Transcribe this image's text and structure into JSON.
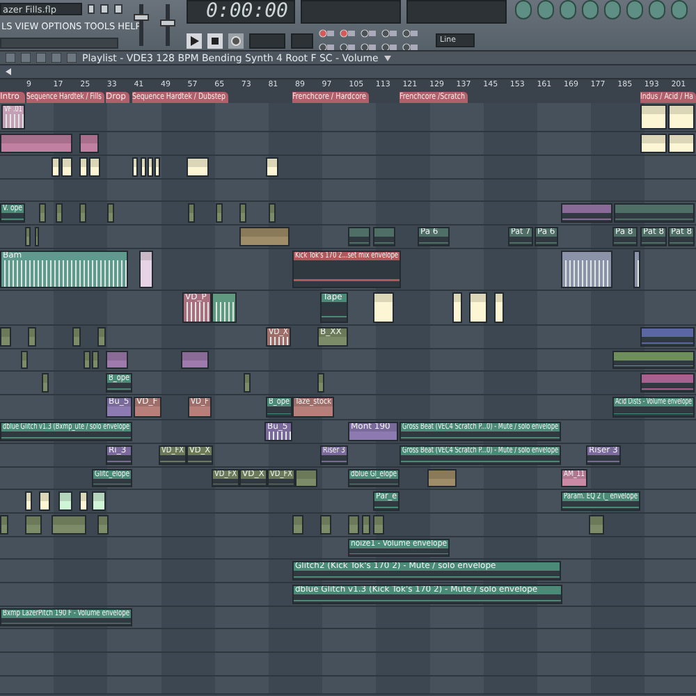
{
  "toolbar": {
    "file_name": "azer Fills.flp",
    "menu": [
      "LS",
      "VIEW",
      "OPTIONS",
      "TOOLS",
      "HELP"
    ],
    "sliders": [
      {
        "level": 0.72
      },
      {
        "level": 0.55
      }
    ],
    "time": "0:00:00",
    "snap": "Line"
  },
  "playlist": {
    "title": "Playlist - VDE3 128 BPM Bending Synth 4 Root F SC - Volume",
    "ruler": [
      "9",
      "17",
      "25",
      "33",
      "41",
      "49",
      "57",
      "65",
      "73",
      "81",
      "89",
      "97",
      "105",
      "113",
      "121",
      "129",
      "137",
      "145",
      "153",
      "161",
      "169",
      "177",
      "185",
      "193",
      "201"
    ],
    "markers": [
      {
        "label": "Intro"
      },
      {
        "label": "Sequence Hardtek / Fills"
      },
      {
        "label": "Drop"
      },
      {
        "label": "Sequence Hardtek / Dubstep"
      },
      {
        "label": "Frenchcore / Hardcore"
      },
      {
        "label": "Frenchcore /Scratch"
      },
      {
        "label": "Indus / Acid / Ha"
      }
    ],
    "tracks": [
      {
        "clips": [
          {
            "label": "VF .01",
            "color": "#c3a0b6",
            "kind": "audio"
          },
          {
            "color": "#dcd6b8",
            "kind": "pattern"
          },
          {
            "color": "#dcd6b8",
            "kind": "pattern"
          }
        ]
      },
      {
        "clips": [
          {
            "color": "#a86f8c",
            "kind": "pattern"
          },
          {
            "color": "#a86f8c",
            "kind": "pattern"
          },
          {
            "color": "#dcd6b8",
            "kind": "pattern"
          },
          {
            "color": "#dcd6b8",
            "kind": "pattern"
          }
        ]
      },
      {
        "clips": [
          {
            "color": "#dcd6b8",
            "kind": "pattern"
          },
          {
            "color": "#dcd6b8",
            "kind": "pattern"
          },
          {
            "color": "#dcd6b8",
            "kind": "pattern"
          },
          {
            "color": "#dcd6b8",
            "kind": "pattern"
          },
          {
            "color": "#dcd6b8",
            "kind": "pattern"
          },
          {
            "color": "#dcd6b8",
            "kind": "pattern"
          },
          {
            "color": "#dcd6b8",
            "kind": "pattern"
          },
          {
            "color": "#dcd6b8",
            "kind": "pattern"
          },
          {
            "color": "#dcd6b8",
            "kind": "pattern"
          },
          {
            "color": "#dcd6b8",
            "kind": "pattern"
          }
        ]
      },
      {
        "clips": [
          {
            "label": "V. ope",
            "color": "#4c8a78",
            "kind": "automation"
          },
          {
            "color": "#6d7a5a",
            "kind": "pattern"
          },
          {
            "color": "#6d7a5a",
            "kind": "pattern"
          },
          {
            "color": "#6d7a5a",
            "kind": "pattern"
          },
          {
            "color": "#6d7a5a",
            "kind": "pattern"
          },
          {
            "color": "#6d7a5a",
            "kind": "pattern"
          },
          {
            "color": "#6d7a5a",
            "kind": "pattern"
          },
          {
            "color": "#6d7a5a",
            "kind": "pattern"
          },
          {
            "color": "#6d7a5a",
            "kind": "pattern"
          },
          {
            "color": "#8a6a96",
            "kind": "automation"
          },
          {
            "color": "#4f6e66",
            "kind": "automation"
          }
        ]
      },
      {
        "clips": [
          {
            "color": "#6d7a5a",
            "kind": "pattern"
          },
          {
            "color": "#6d7a5a",
            "kind": "pattern"
          },
          {
            "color": "#8a7a5a",
            "kind": "pattern"
          },
          {
            "color": "#4f6e66",
            "kind": "automation"
          },
          {
            "color": "#4f6e66",
            "kind": "automation"
          },
          {
            "label": "Pa 6",
            "color": "#4f6e66",
            "kind": "automation"
          },
          {
            "label": "Pat 7",
            "color": "#4f6e66",
            "kind": "automation"
          },
          {
            "label": "Pa 6",
            "color": "#4f6e66",
            "kind": "automation"
          },
          {
            "label": "Pa 8",
            "color": "#4f6e66",
            "kind": "automation"
          },
          {
            "label": "Pat 8",
            "color": "#4f6e66",
            "kind": "automation"
          },
          {
            "label": "Pat 8",
            "color": "#4f6e66",
            "kind": "automation"
          }
        ]
      },
      {
        "clips": [
          {
            "label": "Bam",
            "color": "#5f9a8e",
            "kind": "audio"
          },
          {
            "color": "#c8b8c8",
            "kind": "pattern"
          },
          {
            "label": "Kick Tok's 170 2...set mix envelope",
            "color": "#b0585c",
            "kind": "automation"
          },
          {
            "color": "#8b93a8",
            "kind": "audio"
          },
          {
            "color": "#8b93a8",
            "kind": "audio"
          }
        ]
      },
      {
        "clips": [
          {
            "label": "VD_P",
            "color": "#a8707e",
            "kind": "audio"
          },
          {
            "color": "#5f9a80",
            "kind": "audio"
          },
          {
            "label": "Tape",
            "color": "#4c8a78",
            "kind": "automation"
          },
          {
            "color": "#dcd6b8",
            "kind": "pattern"
          },
          {
            "color": "#dcd6b8",
            "kind": "pattern"
          },
          {
            "color": "#dcd6b8",
            "kind": "pattern"
          },
          {
            "color": "#dcd6b8",
            "kind": "pattern"
          }
        ]
      },
      {
        "clips": [
          {
            "color": "#6d7a5a",
            "kind": "pattern"
          },
          {
            "color": "#6d7a5a",
            "kind": "pattern"
          },
          {
            "color": "#6d7a5a",
            "kind": "pattern"
          },
          {
            "color": "#6d7a5a",
            "kind": "pattern"
          },
          {
            "label": "VD_X",
            "color": "#9e6e6a",
            "kind": "audio"
          },
          {
            "label": "B_XX",
            "color": "#6d7a5a",
            "kind": "pattern"
          },
          {
            "color": "#5b67a3",
            "kind": "automation"
          }
        ]
      },
      {
        "clips": [
          {
            "color": "#6d7a5a",
            "kind": "pattern"
          },
          {
            "color": "#6d7a5a",
            "kind": "pattern"
          },
          {
            "color": "#6d7a5a",
            "kind": "pattern"
          },
          {
            "color": "#8a6a96",
            "kind": "pattern"
          },
          {
            "color": "#8a6a96",
            "kind": "pattern"
          },
          {
            "color": "#6e8f5c",
            "kind": "automation"
          }
        ]
      },
      {
        "clips": [
          {
            "color": "#6d7a5a",
            "kind": "pattern"
          },
          {
            "label": "B_ope",
            "color": "#4c8a78",
            "kind": "automation"
          },
          {
            "color": "#6d7a5a",
            "kind": "pattern"
          },
          {
            "color": "#6d7a5a",
            "kind": "pattern"
          },
          {
            "color": "#a8608f",
            "kind": "automation"
          }
        ]
      },
      {
        "clips": [
          {
            "label": "Bu_5",
            "color": "#7a6a9a",
            "kind": "pattern"
          },
          {
            "label": "VD_F",
            "color": "#9e6e6a",
            "kind": "pattern"
          },
          {
            "label": "VD_F",
            "color": "#9e6e6a",
            "kind": "pattern"
          },
          {
            "label": "B_ope",
            "color": "#4c8a78",
            "kind": "automation"
          },
          {
            "label": "Taze_stock",
            "color": "#9e6e6a",
            "kind": "pattern"
          },
          {
            "label": "Acid Dists - Volume envelope",
            "color": "#4c8a78",
            "kind": "automation"
          }
        ]
      },
      {
        "clips": [
          {
            "label": "dblue Glitch v1.3 (Bxmp_ute / solo envelope",
            "color": "#4c8a78",
            "kind": "automation"
          },
          {
            "label": "Bu_5",
            "color": "#7a6a9a",
            "kind": "audio"
          },
          {
            "label": "Mont 190",
            "color": "#7a6a9a",
            "kind": "pattern"
          },
          {
            "label": "Gross Beat (VEC4 Scratch P...0) - Mute / solo envelope",
            "color": "#4c8a78",
            "kind": "automation"
          }
        ]
      },
      {
        "clips": [
          {
            "label": "Ri_3",
            "color": "#7a6a9a",
            "kind": "automation"
          },
          {
            "label": "VD_FX",
            "color": "#6d7a5a",
            "kind": "automation"
          },
          {
            "label": "VD_X",
            "color": "#6d7a5a",
            "kind": "automation"
          },
          {
            "label": "Riser 3",
            "color": "#7a6a9a",
            "kind": "automation"
          },
          {
            "label": "Gross Beat (VEC4 Scratch P...0) - Mute / solo envelope",
            "color": "#4c8a78",
            "kind": "automation"
          },
          {
            "label": "Riser 3",
            "color": "#7a6a9a",
            "kind": "automation"
          }
        ]
      },
      {
        "clips": [
          {
            "label": "Glitc_elope",
            "color": "#4c8a78",
            "kind": "automation"
          },
          {
            "label": "VD_FX",
            "color": "#6d7a5a",
            "kind": "automation"
          },
          {
            "label": "VD_X",
            "color": "#6d7a5a",
            "kind": "automation"
          },
          {
            "label": "VD_FX",
            "color": "#6d7a5a",
            "kind": "automation"
          },
          {
            "color": "#6d7a5a",
            "kind": "pattern"
          },
          {
            "label": "dblue Gl_elope",
            "color": "#4c8a78",
            "kind": "automation"
          },
          {
            "color": "#8a7a5a",
            "kind": "pattern"
          },
          {
            "label": "AM_11",
            "color": "#b07890",
            "kind": "pattern"
          }
        ]
      },
      {
        "clips": [
          {
            "color": "#dcd6b8",
            "kind": "pattern"
          },
          {
            "color": "#dcd6b8",
            "kind": "pattern"
          },
          {
            "color": "#b5d4bc",
            "kind": "pattern"
          },
          {
            "color": "#dcd6b8",
            "kind": "pattern"
          },
          {
            "color": "#b5d4bc",
            "kind": "pattern"
          },
          {
            "label": "Par_e",
            "color": "#4c8a78",
            "kind": "automation"
          },
          {
            "label": "Param. EQ 2 (_ envelope",
            "color": "#4c8a78",
            "kind": "automation"
          }
        ]
      },
      {
        "clips": [
          {
            "color": "#6d7a5a",
            "kind": "pattern"
          },
          {
            "color": "#6d7a5a",
            "kind": "pattern"
          },
          {
            "color": "#6d7a5a",
            "kind": "pattern"
          },
          {
            "color": "#6d7a5a",
            "kind": "pattern"
          },
          {
            "color": "#6d7a5a",
            "kind": "pattern"
          },
          {
            "color": "#6d7a5a",
            "kind": "pattern"
          },
          {
            "color": "#6d7a5a",
            "kind": "pattern"
          },
          {
            "color": "#6d7a5a",
            "kind": "pattern"
          },
          {
            "color": "#6d7a5a",
            "kind": "pattern"
          },
          {
            "color": "#6d7a5a",
            "kind": "pattern"
          }
        ]
      },
      {
        "clips": [
          {
            "label": "noize1 - Volume envelope",
            "color": "#4c8a78",
            "kind": "automation"
          }
        ]
      },
      {
        "clips": [
          {
            "label": "Glitch2 (Kick Tok's 170 2) - Mute / solo envelope",
            "color": "#4c8a78",
            "kind": "automation"
          }
        ]
      },
      {
        "clips": [
          {
            "label": "dblue Glitch v1.3 (Kick Tok's 170 2) - Mute / solo envelope",
            "color": "#4c8a78",
            "kind": "automation"
          }
        ]
      },
      {
        "clips": [
          {
            "label": "Bxmp LazerPitch 190 F - Volume envelope",
            "color": "#4c8a78",
            "kind": "automation"
          }
        ]
      }
    ]
  }
}
